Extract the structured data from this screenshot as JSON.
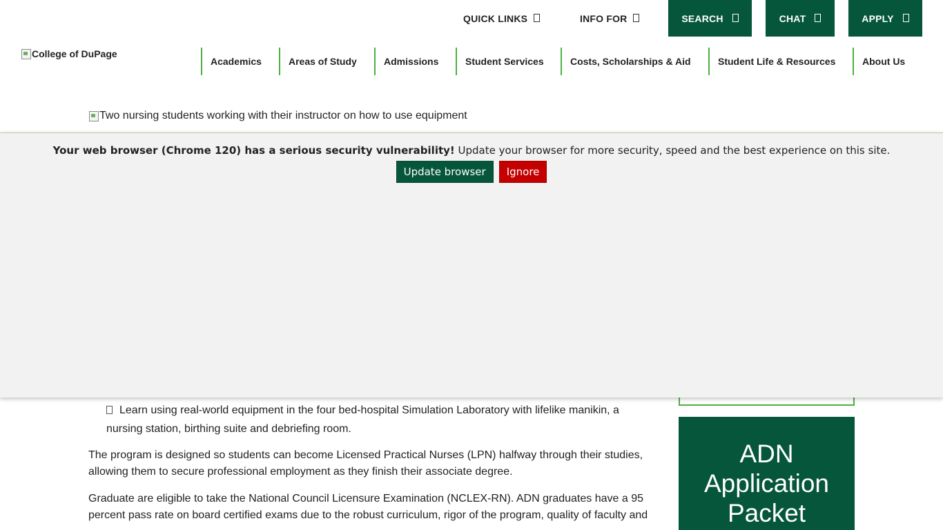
{
  "utility": {
    "quick_links": "QUICK LINKS",
    "info_for": "INFO FOR",
    "search": "SEARCH",
    "chat": "CHAT",
    "apply": "APPLY"
  },
  "logo": {
    "alt": "College of DuPage"
  },
  "nav": {
    "items": [
      "Academics",
      "Areas of Study",
      "Admissions",
      "Student Services",
      "Costs, Scholarships & Aid",
      "Student Life & Resources",
      "About Us"
    ]
  },
  "hero": {
    "alt": "Two nursing students working with their instructor on how to use equipment"
  },
  "content": {
    "bullet": "Learn using real-world equipment in the four bed-hospital Simulation Laboratory with lifelike manikin, a nursing station, birthing suite and debriefing room.",
    "para1": "The program is designed so students can become Licensed Practical Nurses (LPN) halfway through their studies, allowing them to secure professional employment as they finish their associate degree.",
    "para2": "Graduate are eligible to take the National Council Licensure Examination (NCLEX-RN). ADN graduates have a 95 percent pass rate on board certified exams due to the robust curriculum, rigor of the program, quality of faculty and"
  },
  "sidebar": {
    "cta_lines": [
      "ADN",
      "Application",
      "Packet"
    ]
  },
  "browser_warning": {
    "bold": "Your web browser (Chrome 120) has a serious security vulnerability!",
    "text": " Update your browser for more security, speed and the best experience on this site.",
    "update_label": "Update browser",
    "ignore_label": "Ignore"
  },
  "colors": {
    "brand_green": "#05563a",
    "accent_green": "#4caf3f",
    "ignore_red": "#c40000",
    "overlay_bg": "#f2f2f2"
  },
  "icons": {
    "utility_glyph": "chevron-down-icon",
    "broken_image": "broken-image-icon",
    "bullet": "check-box-icon"
  }
}
